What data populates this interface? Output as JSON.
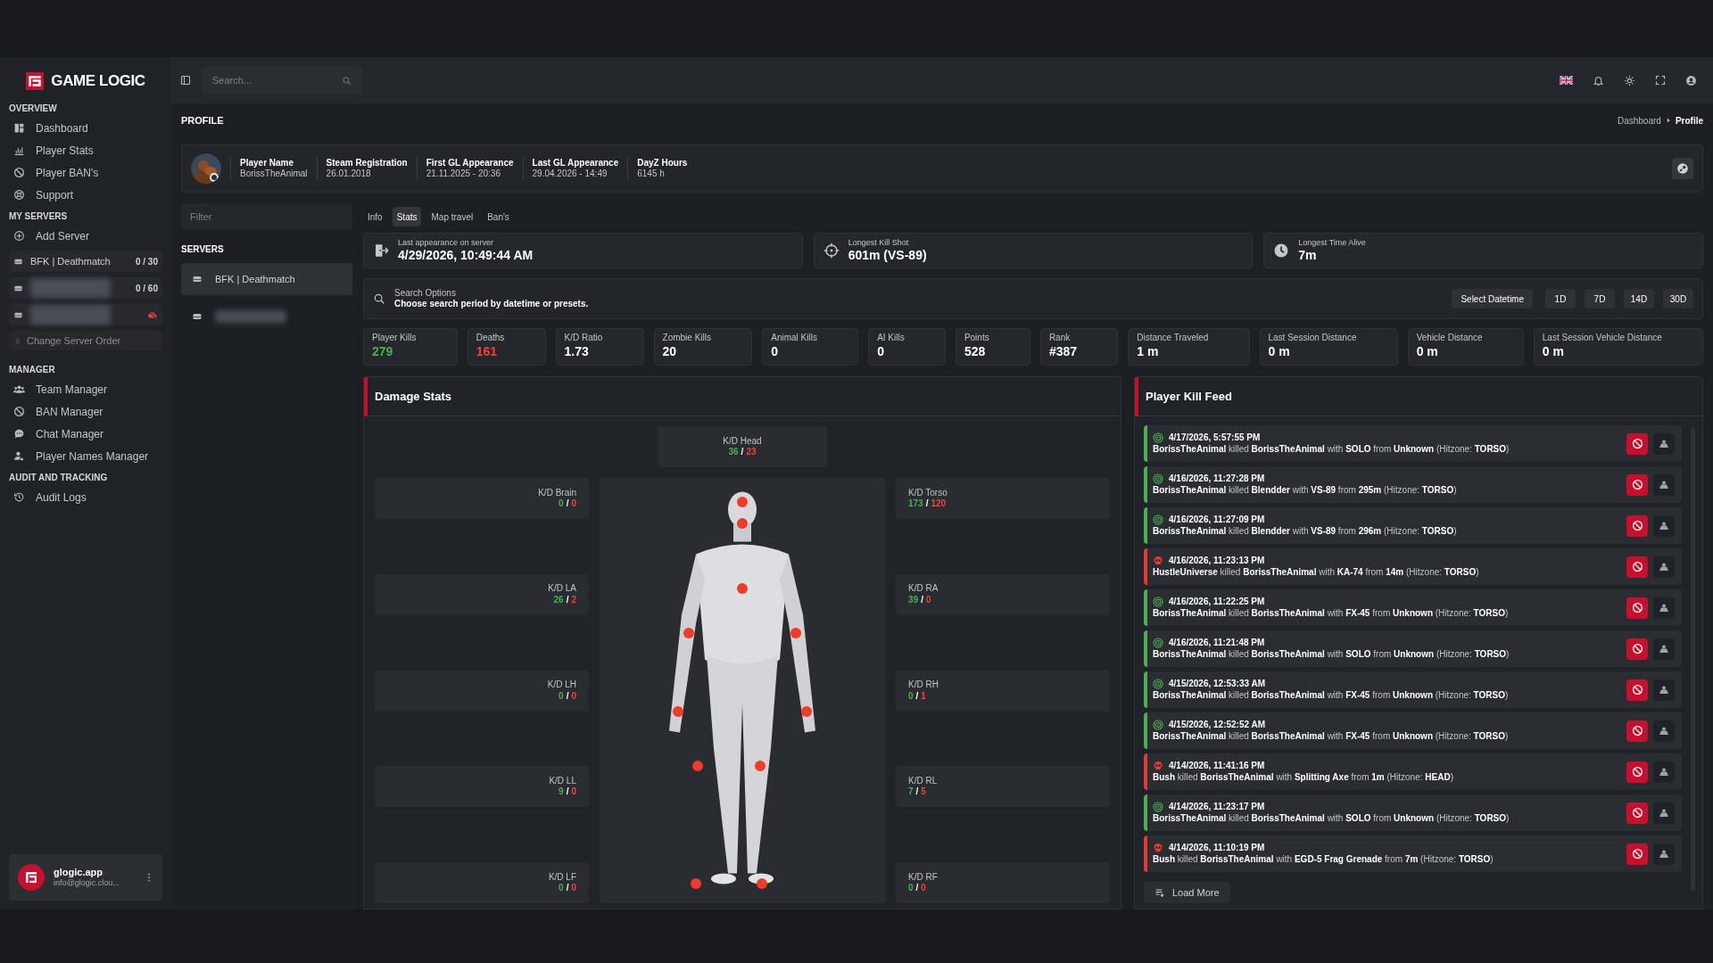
{
  "sidebar": {
    "logo": "GAME LOGIC",
    "sections": [
      {
        "title": "OVERVIEW",
        "items": [
          "Dashboard",
          "Player Stats",
          "Player BAN's",
          "Support"
        ]
      },
      {
        "title": "MY SERVERS",
        "items": [
          "Add Server"
        ],
        "servers": [
          {
            "kind": "named",
            "name": "BFK | Deathmatch",
            "count": "0 / 30"
          },
          {
            "kind": "redacted",
            "count": "0 / 60"
          },
          {
            "kind": "redacted",
            "offline": true
          }
        ],
        "order_button": "Change Server Order"
      },
      {
        "title": "MANAGER",
        "items": [
          "Team Manager",
          "BAN Manager",
          "Chat Manager",
          "Player Names Manager"
        ]
      },
      {
        "title": "AUDIT AND TRACKING",
        "items": [
          "Audit Logs"
        ]
      }
    ],
    "account": {
      "name": "glogic.app",
      "email": "info@glogic.clou..."
    }
  },
  "header": {
    "search": {
      "placeholder": "Search..."
    }
  },
  "page": {
    "title": "PROFILE",
    "breadcrumb": [
      {
        "label": "Dashboard",
        "selected": false
      },
      {
        "label": "Profile",
        "selected": true
      }
    ]
  },
  "profile": {
    "fields": [
      {
        "label": "Player Name",
        "value": "BorissTheAnimal"
      },
      {
        "label": "Steam Registration",
        "value": "26.01.2018"
      },
      {
        "label": "First GL Appearance",
        "value": "21.11.2025 - 20:36"
      },
      {
        "label": "Last GL Appearance",
        "value": "29.04.2026 - 14:49"
      },
      {
        "label": "DayZ Hours",
        "value": "6145 h"
      }
    ]
  },
  "servers_panel": {
    "filter": {
      "placeholder": "Filter"
    },
    "title": "SERVERS",
    "servers": [
      {
        "kind": "named",
        "name": "BFK | Deathmatch",
        "selected": true
      },
      {
        "kind": "redacted",
        "selected": false
      }
    ]
  },
  "tabs": [
    {
      "label": "Info",
      "selected": false
    },
    {
      "label": "Stats",
      "selected": true
    },
    {
      "label": "Map travel",
      "selected": false
    },
    {
      "label": "Ban's",
      "selected": false
    }
  ],
  "highlights": [
    {
      "label": "Last appearance on server",
      "value": "4/29/2026, 10:49:44 AM"
    },
    {
      "label": "Longest Kill Shot",
      "value": "601m (VS-89)"
    },
    {
      "label": "Longest Time Alive",
      "value": "7m"
    }
  ],
  "search_options": {
    "title": "Search Options",
    "hint": "Choose search period by datetime or presets.",
    "buttons": [
      "Select Datetime",
      "1D",
      "7D",
      "14D",
      "30D"
    ]
  },
  "stats": [
    {
      "label": "Player Kills",
      "value": "279",
      "color": "#4caf50"
    },
    {
      "label": "Deaths",
      "value": "161",
      "color": "#f44336"
    },
    {
      "label": "K/D Ratio",
      "value": "1.73",
      "color": "#ffffff"
    },
    {
      "label": "Zombie Kills",
      "value": "20",
      "color": "#ffffff"
    },
    {
      "label": "Animal Kills",
      "value": "0",
      "color": "#ffffff"
    },
    {
      "label": "AI Kills",
      "value": "0",
      "color": "#ffffff"
    },
    {
      "label": "Points",
      "value": "528",
      "color": "#ffffff"
    },
    {
      "label": "Rank",
      "value": "#387",
      "color": "#ffffff"
    },
    {
      "label": "Distance Traveled",
      "value": "1 m",
      "color": "#ffffff"
    },
    {
      "label": "Last Session Distance",
      "value": "0 m",
      "color": "#ffffff"
    },
    {
      "label": "Vehicle Distance",
      "value": "0 m",
      "color": "#ffffff"
    },
    {
      "label": "Last Session Vehicle Distance",
      "value": "0 m",
      "color": "#ffffff"
    }
  ],
  "damage_stats": {
    "title": "Damage Stats",
    "zones": [
      {
        "kind": "top",
        "label": "K/D Head",
        "kills": "36",
        "separator": "/",
        "deaths": "23"
      },
      {
        "kind": "left",
        "label": "K/D Brain",
        "kills": "0",
        "separator": "/",
        "deaths": "0"
      },
      {
        "kind": "right",
        "label": "K/D Torso",
        "kills": "173",
        "separator": "/",
        "deaths": "120"
      },
      {
        "kind": "left",
        "label": "K/D LA",
        "kills": "26",
        "separator": "/",
        "deaths": "2"
      },
      {
        "kind": "right",
        "label": "K/D RA",
        "kills": "39",
        "separator": "/",
        "deaths": "0"
      },
      {
        "kind": "left",
        "label": "K/D LH",
        "kills": "0",
        "separator": "/",
        "deaths": "0"
      },
      {
        "kind": "right",
        "label": "K/D RH",
        "kills": "0",
        "separator": "/",
        "deaths": "1"
      },
      {
        "kind": "left",
        "label": "K/D LL",
        "kills": "9",
        "separator": "/",
        "deaths": "0"
      },
      {
        "kind": "right",
        "label": "K/D RL",
        "kills": "7",
        "separator": "/",
        "deaths": "5"
      },
      {
        "kind": "left",
        "label": "K/D LF",
        "kills": "0",
        "separator": "/",
        "deaths": "0"
      },
      {
        "kind": "right",
        "label": "K/D RF",
        "kills": "0",
        "separator": "/",
        "deaths": "0"
      }
    ]
  },
  "kill_feed": {
    "title": "Player Kill Feed",
    "entries": [
      {
        "kind": "kill",
        "time": "4/17/2026, 5:57:55 PM",
        "text": "**BorissTheAnimal** killed **BorissTheAnimal** with **SOLO** from **Unknown** (Hitzone: **TORSO**)"
      },
      {
        "kind": "kill",
        "time": "4/16/2026, 11:27:28 PM",
        "text": "**BorissTheAnimal** killed **Blendder** with **VS-89** from **295m** (Hitzone: **TORSO**)"
      },
      {
        "kind": "kill",
        "time": "4/16/2026, 11:27:09 PM",
        "text": "**BorissTheAnimal** killed **Blendder** with **VS-89** from **296m** (Hitzone: **TORSO**)"
      },
      {
        "kind": "death",
        "time": "4/16/2026, 11:23:13 PM",
        "text": "**HustleUniverse** killed **BorissTheAnimal** with **KA-74** from **14m** (Hitzone: **TORSO**)"
      },
      {
        "kind": "kill",
        "time": "4/16/2026, 11:22:25 PM",
        "text": "**BorissTheAnimal** killed **BorissTheAnimal** with **FX-45** from **Unknown** (Hitzone: **TORSO**)"
      },
      {
        "kind": "kill",
        "time": "4/16/2026, 11:21:48 PM",
        "text": "**BorissTheAnimal** killed **BorissTheAnimal** with **SOLO** from **Unknown** (Hitzone: **TORSO**)"
      },
      {
        "kind": "kill",
        "time": "4/15/2026, 12:53:33 AM",
        "text": "**BorissTheAnimal** killed **BorissTheAnimal** with **FX-45** from **Unknown** (Hitzone: **TORSO**)"
      },
      {
        "kind": "kill",
        "time": "4/15/2026, 12:52:52 AM",
        "text": "**BorissTheAnimal** killed **BorissTheAnimal** with **FX-45** from **Unknown** (Hitzone: **TORSO**)"
      },
      {
        "kind": "death",
        "time": "4/14/2026, 11:41:16 PM",
        "text": "**Bush** killed **BorissTheAnimal** with **Splitting Axe** from **1m** (Hitzone: **HEAD**)"
      },
      {
        "kind": "kill",
        "time": "4/14/2026, 11:23:17 PM",
        "text": "**BorissTheAnimal** killed **BorissTheAnimal** with **SOLO** from **Unknown** (Hitzone: **TORSO**)"
      },
      {
        "kind": "death",
        "time": "4/14/2026, 11:10:19 PM",
        "text": "**Bush** killed **BorissTheAnimal** with **EGD-5 Frag Grenade** from **7m** (Hitzone: **TORSO**)"
      }
    ],
    "load_more": "Load More"
  }
}
